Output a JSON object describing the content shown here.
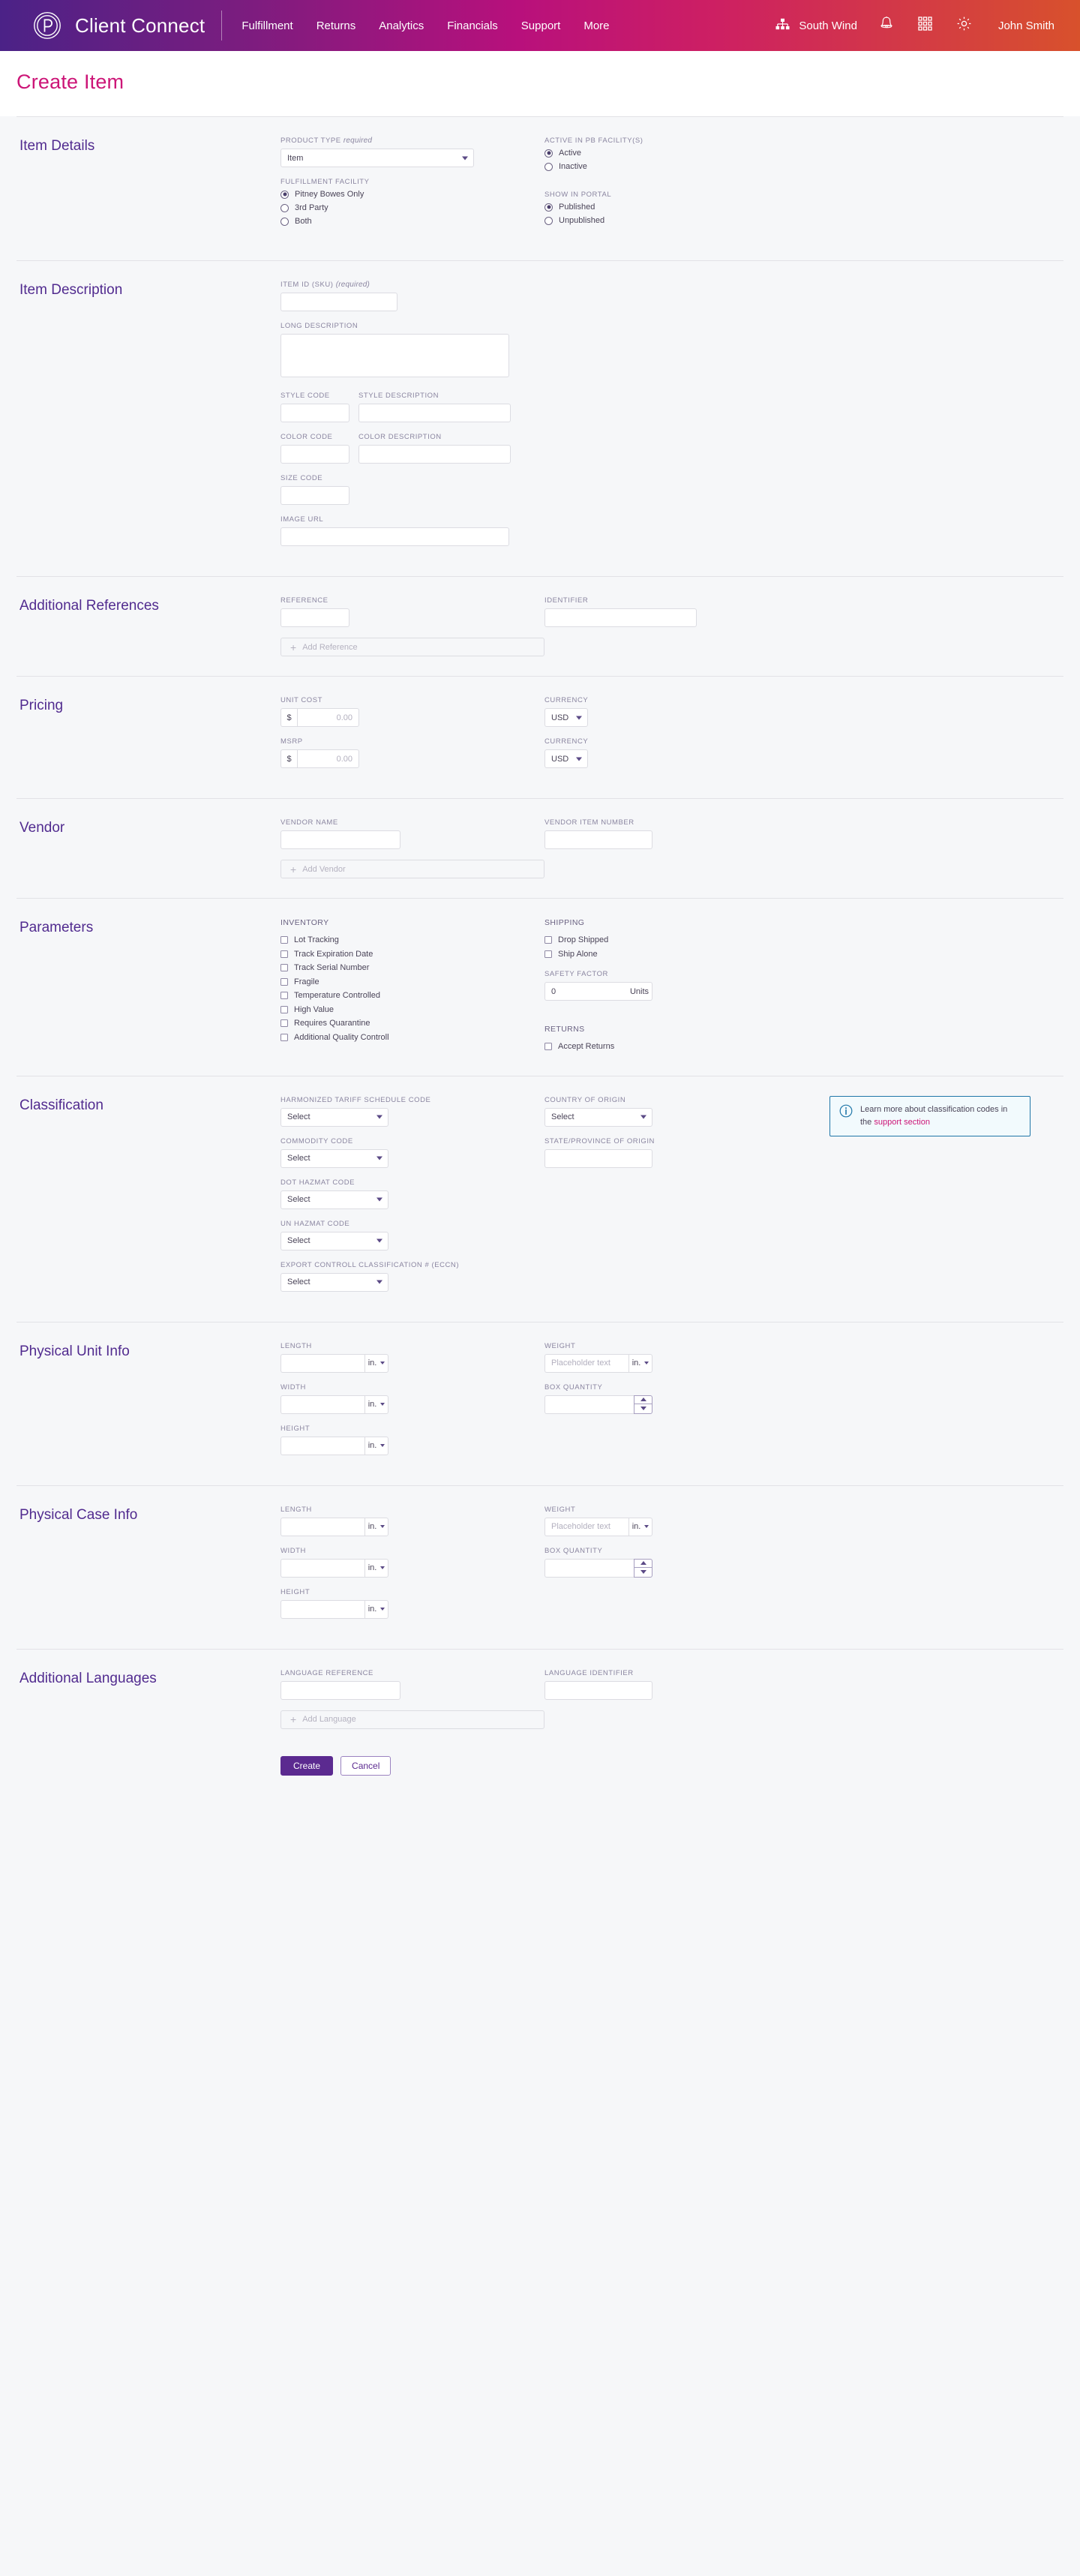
{
  "header": {
    "brand": "Client Connect",
    "nav": [
      {
        "label": "Fulfillment"
      },
      {
        "label": "Returns"
      },
      {
        "label": "Analytics"
      },
      {
        "label": "Financials"
      },
      {
        "label": "Support"
      },
      {
        "label": "More"
      }
    ],
    "org": "South Wind",
    "user": "John Smith",
    "icons": {
      "org": "org-tree-icon",
      "bell": "bell-icon",
      "apps": "apps-grid-icon",
      "gear": "gear-icon"
    },
    "gradient_from": "#4b2287",
    "gradient_to": "#d8512c"
  },
  "page": {
    "title": "Create Item",
    "title_color": "#cc1577",
    "section_title_color": "#512b8f"
  },
  "item_details": {
    "title": "Item Details",
    "product_type": {
      "label": "PRODUCT TYPE",
      "required_note": "required",
      "value": "Item"
    },
    "fulfillment_facility": {
      "label": "FULFILLMENT FACILITY",
      "options": [
        "Pitney Bowes Only",
        "3rd Party",
        "Both"
      ],
      "selected": "Pitney Bowes Only"
    },
    "active_in_pb": {
      "label": "ACTIVE IN PB FACILITY(S)",
      "options": [
        "Active",
        "Inactive"
      ],
      "selected": "Active"
    },
    "show_in_portal": {
      "label": "SHOW IN PORTAL",
      "options": [
        "Published",
        "Unpublished"
      ],
      "selected": "Published"
    }
  },
  "item_description": {
    "title": "Item Description",
    "item_id": {
      "label": "ITEM ID (SKU)",
      "required_note": "(required)",
      "value": ""
    },
    "long_description": {
      "label": "LONG DESCRIPTION",
      "value": ""
    },
    "style_code": {
      "label": "STYLE CODE",
      "value": ""
    },
    "style_description": {
      "label": "STYLE DESCRIPTION",
      "value": ""
    },
    "color_code": {
      "label": "COLOR CODE",
      "value": ""
    },
    "color_description": {
      "label": "COLOR DESCRIPTION",
      "value": ""
    },
    "size_code": {
      "label": "SIZE CODE",
      "value": ""
    },
    "image_url": {
      "label": "IMAGE URL",
      "value": ""
    }
  },
  "additional_references": {
    "title": "Additional References",
    "reference": {
      "label": "REFERENCE",
      "value": ""
    },
    "identifier": {
      "label": "IDENTIFIER",
      "value": ""
    },
    "add_button": "Add Reference"
  },
  "pricing": {
    "title": "Pricing",
    "unit_cost": {
      "label": "UNIT COST",
      "prefix": "$",
      "placeholder": "0.00",
      "value": ""
    },
    "unit_cost_currency": {
      "label": "CURRENCY",
      "value": "USD"
    },
    "msrp": {
      "label": "MSRP",
      "prefix": "$",
      "placeholder": "0.00",
      "value": ""
    },
    "msrp_currency": {
      "label": "CURRENCY",
      "value": "USD"
    }
  },
  "vendor": {
    "title": "Vendor",
    "vendor_name": {
      "label": "VENDOR NAME",
      "value": ""
    },
    "vendor_item_number": {
      "label": "VENDOR ITEM NUMBER",
      "value": ""
    },
    "add_button": "Add Vendor"
  },
  "parameters": {
    "title": "Parameters",
    "inventory": {
      "label": "INVENTORY",
      "items": [
        {
          "label": "Lot Tracking",
          "checked": false
        },
        {
          "label": "Track Expiration Date",
          "checked": false
        },
        {
          "label": "Track Serial Number",
          "checked": false
        },
        {
          "label": "Fragile",
          "checked": false
        },
        {
          "label": "Temperature Controlled",
          "checked": false
        },
        {
          "label": "High Value",
          "checked": false
        },
        {
          "label": "Requires Quarantine",
          "checked": false
        },
        {
          "label": "Additional Quality Controll",
          "checked": false
        }
      ]
    },
    "shipping": {
      "label": "SHIPPING",
      "items": [
        {
          "label": "Drop Shipped",
          "checked": false
        },
        {
          "label": "Ship Alone",
          "checked": false
        }
      ]
    },
    "safety_factor": {
      "label": "SAFETY FACTOR",
      "value": "0",
      "unit": "Units"
    },
    "returns": {
      "label": "RETURNS",
      "items": [
        {
          "label": "Accept Returns",
          "checked": false
        }
      ]
    }
  },
  "classification": {
    "title": "Classification",
    "hts_code": {
      "label": "HARMONIZED TARIFF SCHEDULE CODE",
      "value": "Select"
    },
    "commodity_code": {
      "label": "COMMODITY CODE",
      "value": "Select"
    },
    "dot_hazmat_code": {
      "label": "DOT HAZMAT CODE",
      "value": "Select"
    },
    "un_hazmat_code": {
      "label": "UN HAZMAT CODE",
      "value": "Select"
    },
    "eccn": {
      "label": "EXPORT CONTROLL CLASSIFICATION # (ECCN)",
      "value": "Select"
    },
    "country_of_origin": {
      "label": "COUNTRY OF ORIGIN",
      "value": "Select"
    },
    "state_of_origin": {
      "label": "STATE/PROVINCE OF ORIGIN",
      "value": ""
    },
    "callout": {
      "text_before": "Learn more about classification codes in the ",
      "link": "support section",
      "border_color": "#1f76a8",
      "bg_color": "#f2fafd"
    }
  },
  "physical_unit_info": {
    "title": "Physical Unit Info",
    "length": {
      "label": "LENGTH",
      "value": "",
      "unit": "in."
    },
    "width": {
      "label": "WIDTH",
      "value": "",
      "unit": "in."
    },
    "height": {
      "label": "HEIGHT",
      "value": "",
      "unit": "in."
    },
    "weight": {
      "label": "WEIGHT",
      "placeholder": "Placeholder text",
      "value": "",
      "unit": "in."
    },
    "box_quantity": {
      "label": "BOX QUANTITY",
      "value": ""
    }
  },
  "physical_case_info": {
    "title": "Physical Case Info",
    "length": {
      "label": "LENGTH",
      "value": "",
      "unit": "in."
    },
    "width": {
      "label": "WIDTH",
      "value": "",
      "unit": "in."
    },
    "height": {
      "label": "HEIGHT",
      "value": "",
      "unit": "in."
    },
    "weight": {
      "label": "WEIGHT",
      "placeholder": "Placeholder text",
      "value": "",
      "unit": "in."
    },
    "box_quantity": {
      "label": "BOX QUANTITY",
      "value": ""
    }
  },
  "additional_languages": {
    "title": "Additional Languages",
    "language_reference": {
      "label": "LANGUAGE REFERENCE",
      "value": ""
    },
    "language_identifier": {
      "label": "LANGUAGE IDENTIFIER",
      "value": ""
    },
    "add_button": "Add Language"
  },
  "footer": {
    "create": "Create",
    "cancel": "Cancel"
  }
}
